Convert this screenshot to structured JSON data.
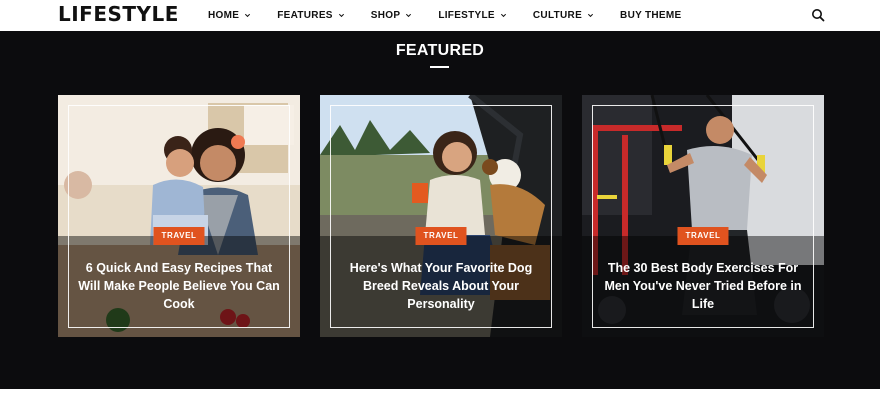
{
  "header": {
    "logo": "LIFESTYLE",
    "nav": [
      {
        "label": "HOME",
        "has_dropdown": true
      },
      {
        "label": "FEATURES",
        "has_dropdown": true
      },
      {
        "label": "SHOP",
        "has_dropdown": true
      },
      {
        "label": "LIFESTYLE",
        "has_dropdown": true
      },
      {
        "label": "CULTURE",
        "has_dropdown": true
      },
      {
        "label": "BUY THEME",
        "has_dropdown": false
      }
    ],
    "search_icon": "search-icon"
  },
  "featured": {
    "heading": "FEATURED",
    "cards": [
      {
        "category": "TRAVEL",
        "title": "6 Quick And Easy Recipes That Will Make People Believe You Can Cook"
      },
      {
        "category": "TRAVEL",
        "title": "Here's What Your Favorite Dog Breed Reveals About Your Personality"
      },
      {
        "category": "TRAVEL",
        "title": "The 30 Best Body Exercises For Men You've Never Tried Before in Life"
      }
    ]
  },
  "colors": {
    "band_bg": "#0c0c0e",
    "badge": "#e0531f",
    "text_dark": "#111111"
  }
}
